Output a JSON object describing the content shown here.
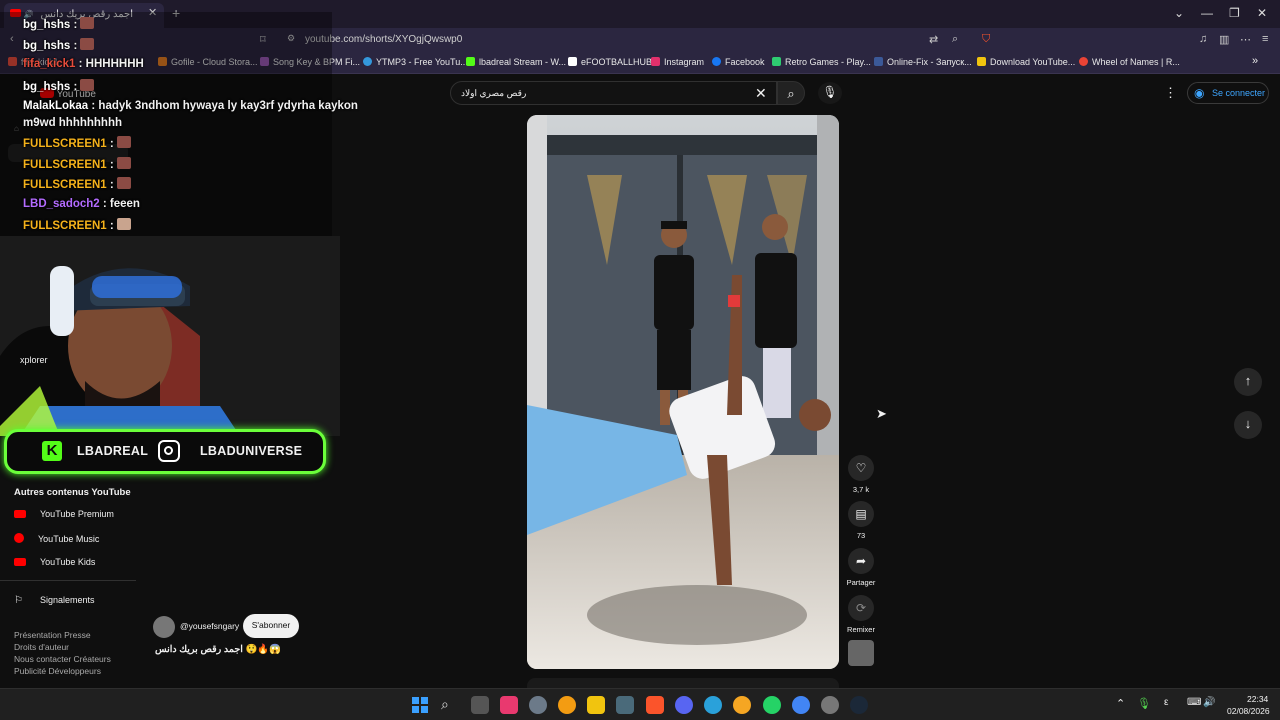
{
  "browser": {
    "tab_title": "اجمد رقص بريك دانس",
    "url": "youtube.com/shorts/XYOgjQwswp0",
    "bookmarks": [
      "fifa_kick1",
      "Gofile - Cloud Stora...",
      "Song Key & BPM Fi...",
      "YTMP3 - Free YouTu...",
      "lbadreal Stream - W...",
      "eFOOTBALLHUB",
      "Instagram",
      "Facebook",
      "Retro Games - Play...",
      "Online-Fix - Запуск...",
      "Download YouTube...",
      "Wheel of Names | R..."
    ],
    "bookmark_colors": [
      "#e74c3c",
      "#e67e22",
      "#9b59b6",
      "#3498db",
      "#53fc18",
      "#ffffff",
      "#e1306c",
      "#1877f2",
      "#2ecc71",
      "#3b5998",
      "#f1c40f",
      "#ea4335"
    ]
  },
  "youtube": {
    "logo_text": "YouTube",
    "search_value": "رقص مصري اولاد",
    "signin_label": "Se connecter",
    "sidebar": {
      "section_title": "Autres contenus YouTube",
      "items": [
        {
          "label": "YouTube Premium",
          "icon": "youtube-premium-icon"
        },
        {
          "label": "YouTube Music",
          "icon": "youtube-music-icon"
        },
        {
          "label": "YouTube Kids",
          "icon": "youtube-kids-icon"
        }
      ],
      "report_label": "Signalements",
      "footer_lines": [
        "Présentation  Presse",
        "Droits d'auteur",
        "Nous contacter  Créateurs",
        "Publicité  Développeurs"
      ]
    },
    "short": {
      "likes": "3,7 k",
      "comments": "73",
      "share_label": "Partager",
      "remix_label": "Remixer",
      "channel": "@yousefsngary",
      "subscribe_label": "S'abonner",
      "title": "اجمد رقص بريك دانس 😲🔥😱"
    }
  },
  "overlay": {
    "chat": [
      {
        "user": "bg_hshs",
        "text": ":",
        "color": "#ffffff",
        "emote": true
      },
      {
        "user": "bg_hshs",
        "text": ":",
        "color": "#ffffff",
        "emote": true
      },
      {
        "user": "fifa_kick1",
        "text": ": HHHHHHH",
        "color": "#e74c3c",
        "emote": false
      },
      {
        "user": "bg_hshs",
        "text": ":",
        "color": "#ffffff",
        "emote": true
      },
      {
        "user": "MalakLokaa",
        "text": ": hadyk 3ndhom hywaya ly kay3rf ydyrha kaykon",
        "color": "#ffffff",
        "emote": false
      },
      {
        "user": "",
        "text": "m9wd hhhhhhhhh",
        "color": "#ffffff",
        "emote": false
      },
      {
        "user": "FULLSCREEN1",
        "text": ":",
        "color": "#f5b21b",
        "emote": true
      },
      {
        "user": "FULLSCREEN1",
        "text": ":",
        "color": "#f5b21b",
        "emote": true
      },
      {
        "user": "FULLSCREEN1",
        "text": ":",
        "color": "#f5b21b",
        "emote": true
      },
      {
        "user": "LBD_sadoch2",
        "text": ": feeen",
        "color": "#b36bff",
        "emote": false
      },
      {
        "user": "FULLSCREEN1",
        "text": ":",
        "color": "#f5b21b",
        "emote": true
      }
    ],
    "webcam_caption": "xplorer",
    "kick_handle": "LBADREAL",
    "instagram_handle": "LBADUNIVERSE"
  },
  "taskbar": {
    "time": "22:34",
    "date": "02/08/2026"
  }
}
